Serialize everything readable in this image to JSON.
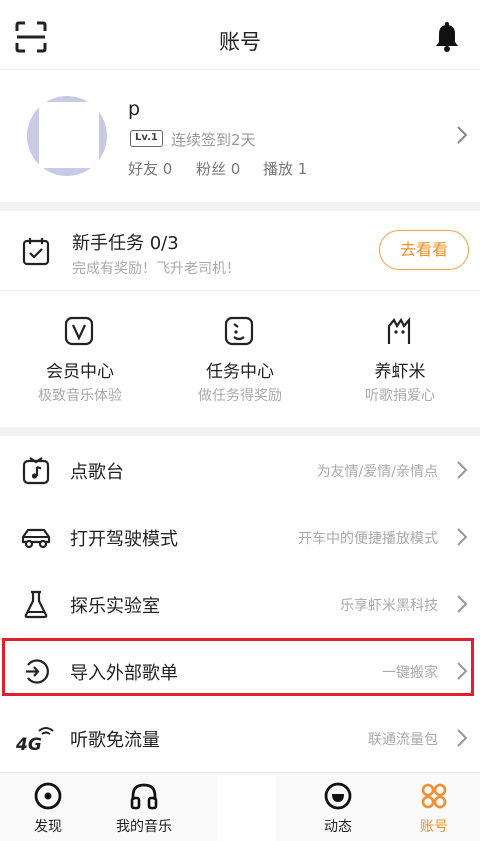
{
  "header": {
    "title": "账号"
  },
  "profile": {
    "username": "p",
    "level": "Lv.1",
    "signin": "连续签到2天",
    "stats": {
      "friends": "好友 0",
      "fans": "粉丝 0",
      "plays": "播放 1"
    }
  },
  "task": {
    "title": "新手任务 0/3",
    "subtitle": "完成有奖励！飞升老司机！",
    "button": "去看看"
  },
  "shortcuts": [
    {
      "title": "会员中心",
      "sub": "极致音乐体验",
      "icon": "vip-v-icon"
    },
    {
      "title": "任务中心",
      "sub": "做任务得奖励",
      "icon": "task-face-icon"
    },
    {
      "title": "养虾米",
      "sub": "听歌捐爱心",
      "icon": "shrimp-icon"
    }
  ],
  "list": [
    {
      "title": "点歌台",
      "hint": "为友情/爱情/亲情点",
      "icon": "song-request-icon"
    },
    {
      "title": "打开驾驶模式",
      "hint": "开车中的便捷播放模式",
      "icon": "car-icon"
    },
    {
      "title": "探乐实验室",
      "hint": "乐享虾米黑科技",
      "icon": "flask-icon"
    },
    {
      "title": "导入外部歌单",
      "hint": "一键搬家",
      "icon": "import-icon"
    },
    {
      "title": "听歌免流量",
      "hint": "联通流量包",
      "icon": "4g-icon"
    }
  ],
  "tabs": [
    {
      "label": "发现"
    },
    {
      "label": "我的音乐"
    },
    {
      "label": "动态"
    },
    {
      "label": "账号"
    }
  ],
  "colors": {
    "accent": "#f09030",
    "highlight": "#e0202a"
  }
}
